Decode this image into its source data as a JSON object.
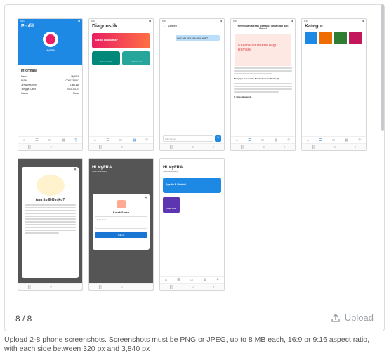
{
  "counter": "8 / 8",
  "upload_label": "Upload",
  "help_text": "Upload 2-8 phone screenshots. Screenshots must be PNG or JPEG, up to 8 MB each, 16:9 or 9:16 aspect ratio, with each side between 320 px and 3,840 px",
  "p1": {
    "title": "Profil",
    "name": "MyFRA",
    "section": "Informasi",
    "rows": [
      [
        "Nama",
        "MyFRA"
      ],
      [
        "NISN",
        "0091234567"
      ],
      [
        "Jenis Kelamin",
        "Laki-laki"
      ],
      [
        "Tanggal Lahir",
        "2010-04-21"
      ],
      [
        "Status",
        "Siswa"
      ]
    ]
  },
  "p2": {
    "title": "Diagnostik",
    "banner": "Apa itu Diagnostik?",
    "btn1": "Rekomendasi",
    "btn2": "Ke Konselor"
  },
  "p3": {
    "title": "Asisten",
    "msg": "Halo! Ada yang bisa saya bantu?",
    "placeholder": "Tulis Pesan"
  },
  "p4": {
    "title": "Kesehatan Mental Remaja: Tantangan dan Solusi",
    "img": "Kesehatan Mental bagi Remaja",
    "h1": "Mengapa Kesehatan Mental Remaja Penting?",
    "h2": "1. Stres akademik"
  },
  "p5": {
    "title": "Kategori"
  },
  "p6": {
    "title": "Apa itu E-Bimko?"
  },
  "p7": {
    "greet": "Hi MyFRA",
    "sub": "Selamat Datang",
    "modal_title": "Kotak Saran",
    "placeholder": "Tulis Saran",
    "submit": "Submit"
  },
  "p8": {
    "greet": "Hi MyFRA",
    "sub": "Selamat Datang",
    "banner": "Apa itu E-Bimko?",
    "tile": "Kotak Saran"
  },
  "colors": {
    "blue": "#1e88e5",
    "accent": "#e91e63"
  }
}
